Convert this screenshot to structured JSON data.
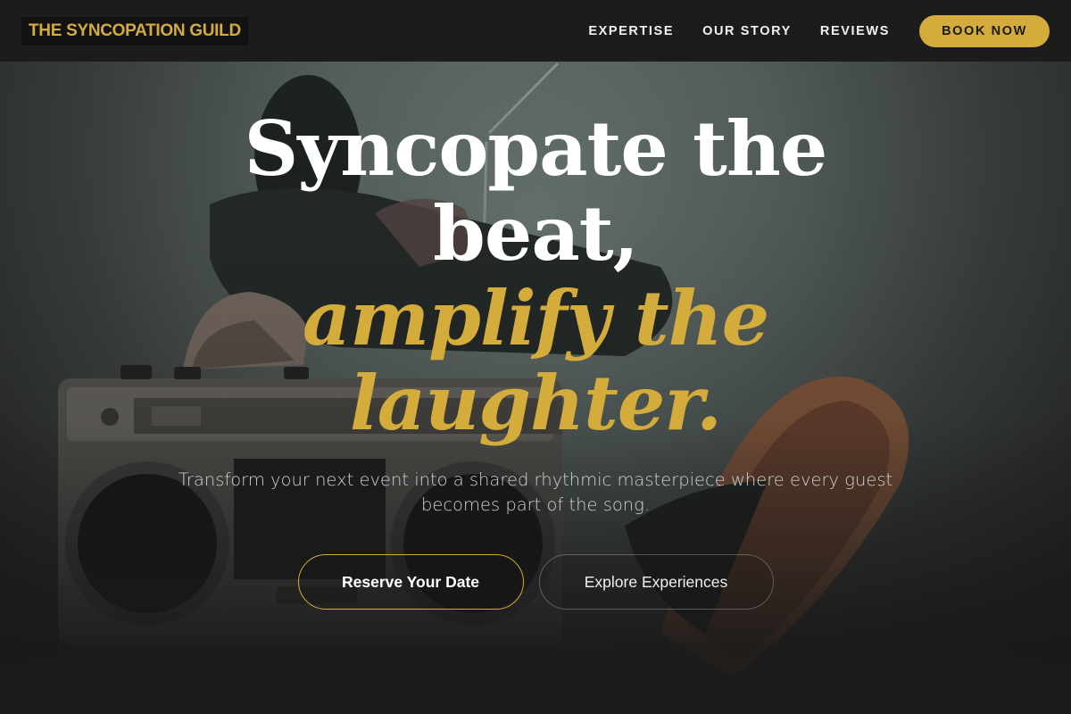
{
  "brand": {
    "name": "THE SYNCOPATION GUILD"
  },
  "nav": {
    "links": [
      "EXPERTISE",
      "OUR STORY",
      "REVIEWS"
    ],
    "cta_label": "BOOK NOW"
  },
  "hero": {
    "headline_line1": "Syncopate the",
    "headline_line2": "beat,",
    "headline_accent_line1": "amplify the",
    "headline_accent_line2": "laughter.",
    "subtext": "Transform your next event into a shared rhythmic masterpiece where every guest becomes part of the song.",
    "primary_cta": "Reserve Your Date",
    "secondary_cta": "Explore Experiences"
  },
  "colors": {
    "accent": "#d4ac3c",
    "nav_bg": "#1c1c1c",
    "text": "#ffffff"
  },
  "icons": [
    "boombox-illustration"
  ]
}
